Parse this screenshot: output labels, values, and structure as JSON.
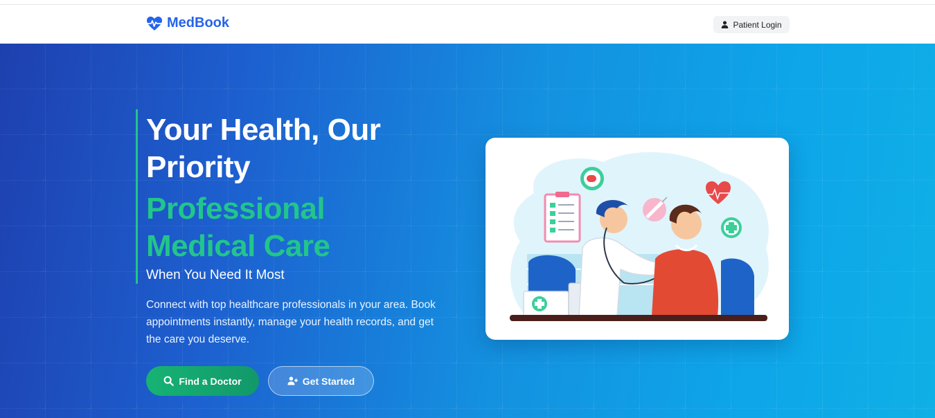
{
  "navbar": {
    "brand_name": "MedBook",
    "brand_icon": "heartbeat-icon",
    "login_label": "Patient Login",
    "login_icon": "user-icon"
  },
  "hero": {
    "title_line1": "Your Health, Our Priority",
    "title_line2": "Professional Medical Care",
    "subtitle": "When You Need It Most",
    "description": "Connect with top healthcare professionals in your area. Book appointments instantly, manage your health records, and get the care you deserve.",
    "find_doctor_label": "Find a Doctor",
    "find_doctor_icon": "search-icon",
    "get_started_label": "Get Started",
    "get_started_icon": "user-plus-icon"
  },
  "colors": {
    "brand": "#2563eb",
    "accent_green": "#22c58b",
    "hero_start": "#1e40af",
    "hero_end": "#0ea5e9"
  }
}
